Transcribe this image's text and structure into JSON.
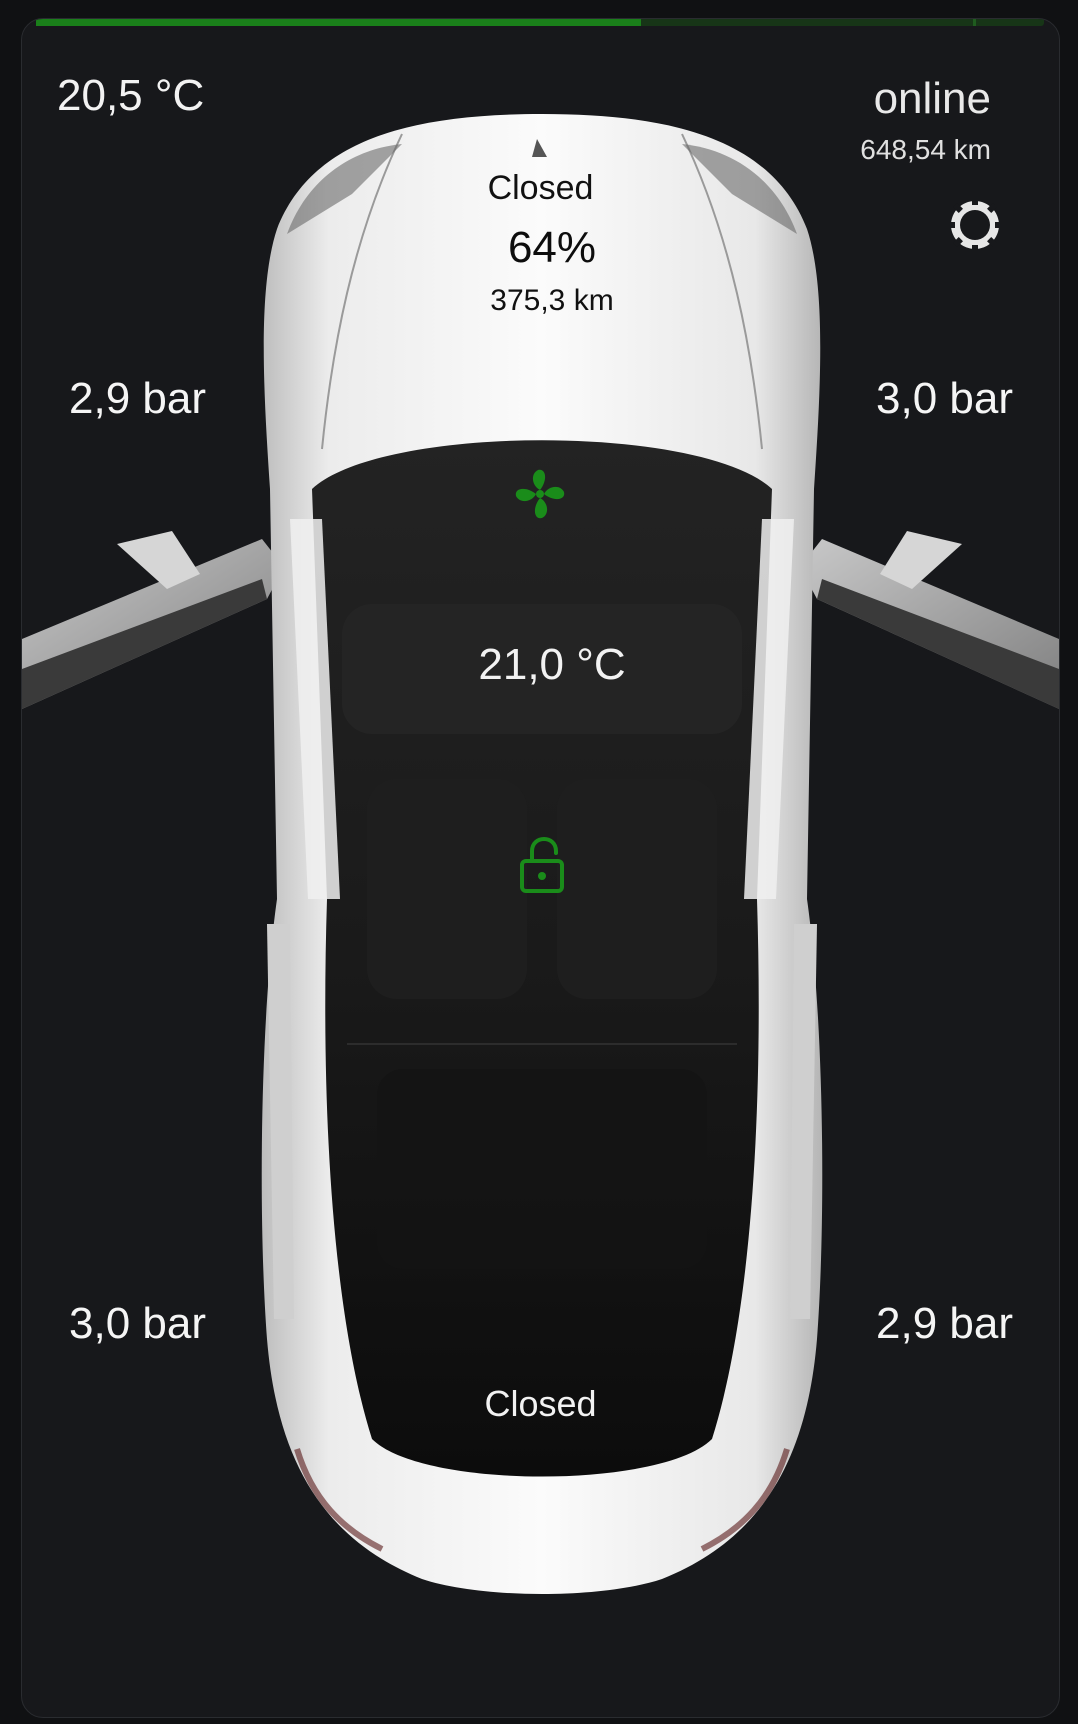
{
  "progress": {
    "fill_fraction": 0.6,
    "marker_fraction": 0.93,
    "color": "#1a7f1a"
  },
  "header": {
    "outside_temperature": "20,5 °C",
    "connection_status": "online",
    "odometer": "648,54 km"
  },
  "frunk": {
    "state": "Closed"
  },
  "battery": {
    "level": "64%",
    "range": "375,3 km"
  },
  "tires": {
    "front_left": "2,9 bar",
    "front_right": "3,0 bar",
    "rear_left": "3,0 bar",
    "rear_right": "2,9 bar"
  },
  "cabin": {
    "inside_temperature": "21,0 °C",
    "climate_icon": "fan-icon",
    "lock_icon": "unlocked-icon",
    "icon_color": "#1a8c1a"
  },
  "trunk": {
    "state": "Closed"
  },
  "settings_icon": "gear-icon"
}
